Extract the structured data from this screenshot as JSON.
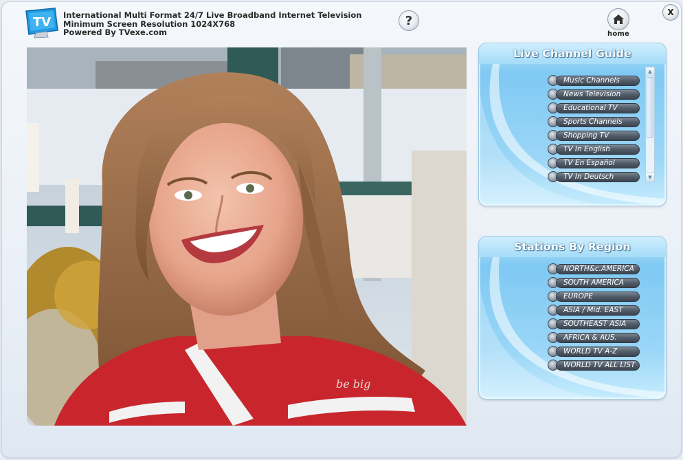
{
  "header": {
    "logo_text": "TV",
    "line1": "International Multi Format 24/7 Live Broadband Internet Television",
    "line2": "Minimum Screen Resolution 1024X768",
    "line3": "Powered By TVexe.com",
    "help_label": "?",
    "home_label": "home",
    "close_label": "X"
  },
  "guide": {
    "title": "Live Channel Guide",
    "items": [
      {
        "label": "Music Channels"
      },
      {
        "label": "News Television"
      },
      {
        "label": "Educational TV"
      },
      {
        "label": "Sports Channels"
      },
      {
        "label": "Shopping TV"
      },
      {
        "label": "TV In English"
      },
      {
        "label": "TV En Español"
      },
      {
        "label": "TV In Deutsch"
      }
    ]
  },
  "region": {
    "title": "Stations By Region",
    "items": [
      {
        "label": "NORTH&c.AMERICA"
      },
      {
        "label": "SOUTH AMERICA"
      },
      {
        "label": "EUROPE"
      },
      {
        "label": "ASIA / Mid. EAST"
      },
      {
        "label": "SOUTHEAST ASIA"
      },
      {
        "label": "AFRICA & AUS."
      },
      {
        "label": "WORLD TV A-Z"
      },
      {
        "label": "WORLD TV ALL LIST"
      }
    ]
  },
  "video": {
    "shirt_text": "be big"
  },
  "colors": {
    "panel": "#8fd0f5",
    "button": "#515c68",
    "accent": "#2a93d8"
  }
}
